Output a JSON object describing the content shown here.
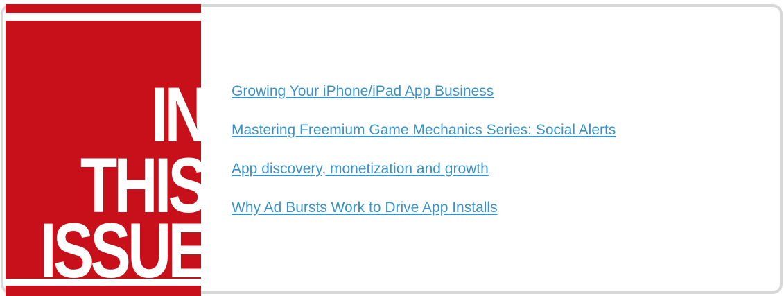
{
  "banner": {
    "word1": "IN",
    "word2": "THIS",
    "word3": "ISSUE"
  },
  "links": [
    {
      "label": "Growing Your iPhone/iPad App Business"
    },
    {
      "label": "Mastering Freemium Game Mechanics Series: Social Alerts"
    },
    {
      "label": "App discovery, monetization and growth"
    },
    {
      "label": "Why Ad Bursts Work to Drive App Installs"
    }
  ],
  "colors": {
    "banner": "#c8101a",
    "link": "#3a93c8",
    "border": "#d8d8d8"
  }
}
